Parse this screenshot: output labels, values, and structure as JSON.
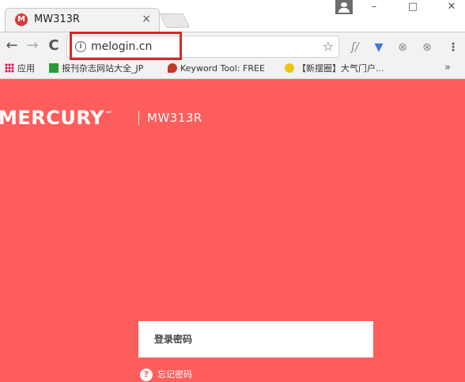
{
  "tab": {
    "title": "MW313R",
    "favicon_letter": "M",
    "close": "×"
  },
  "window_controls": {
    "minimize": "–",
    "maximize": "□",
    "close": "✕"
  },
  "toolbar": {
    "back": "←",
    "forward": "→",
    "reload": "C",
    "url": "melogin.cn",
    "info": "i",
    "bookmark_star": "☆"
  },
  "extensions": [
    "ʃ/",
    "▼",
    "⊗",
    "⊗",
    "⋮"
  ],
  "bookmarks": {
    "apps_label": "应用",
    "items": [
      {
        "label": "报刊杂志网站大全_JP"
      },
      {
        "label": "Keyword Tool: FREE"
      },
      {
        "label": "【新摆圈】大气门户..."
      }
    ],
    "more": "»"
  },
  "page": {
    "brand": "MERCURY",
    "brand_tm": "™",
    "model": "MW313R",
    "password_label": "登录密码",
    "forgot_label": "忘记密码",
    "forgot_icon": "?"
  },
  "colors": {
    "page_background": "#fd5e5c",
    "highlight_border": "#d62828"
  }
}
